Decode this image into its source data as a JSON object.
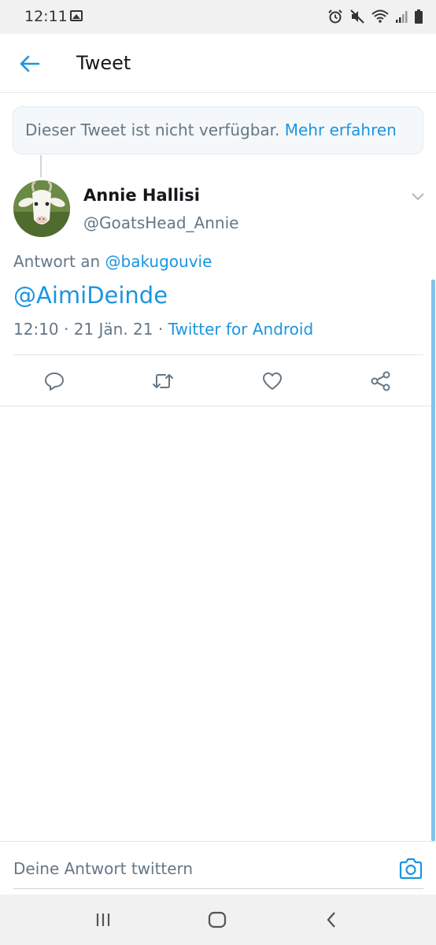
{
  "status_bar": {
    "time": "12:11",
    "icons": [
      "image-icon",
      "alarm-icon",
      "mute-icon",
      "wifi-icon",
      "signal-icon",
      "battery-icon"
    ]
  },
  "header": {
    "title": "Tweet",
    "back_icon": "arrow-left-icon"
  },
  "notice": {
    "text": "Dieser Tweet ist nicht verfügbar.",
    "link": "Mehr erfahren"
  },
  "tweet": {
    "author_name": "Annie Hallisi",
    "author_handle": "@GoatsHead_Annie",
    "reply_prefix": "Antwort an",
    "reply_to": "@bakugouvie",
    "text": "@AimiDeinde",
    "time_date": "12:10 · 21 Jän. 21 ·",
    "source": "Twitter for Android",
    "actions": [
      "reply-icon",
      "retweet-icon",
      "like-icon",
      "share-icon"
    ]
  },
  "composer": {
    "placeholder": "Deine Antwort twittern"
  },
  "nav_bar": {
    "buttons": [
      "recents-icon",
      "home-icon",
      "back-icon"
    ]
  },
  "colors": {
    "accent": "#1b95e0",
    "secondary_text": "#657786",
    "border": "#e1e8ed"
  }
}
